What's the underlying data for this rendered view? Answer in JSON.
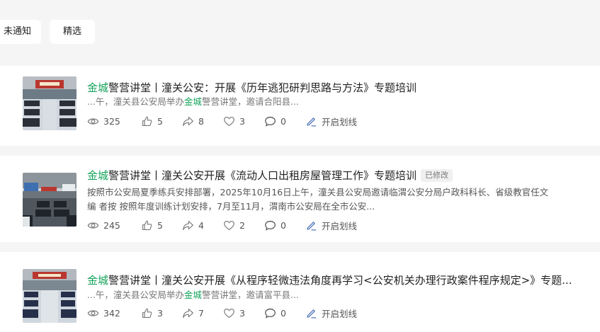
{
  "filters": [
    {
      "label": "未通知"
    },
    {
      "label": "精选"
    }
  ],
  "articles": [
    {
      "title_prefix": "金城",
      "title_rest": "警营讲堂丨潼关公安：开展《历年逃犯研判思路与方法》专题培训",
      "badge": "",
      "snippet_a": "...午，潼关县公安局举办",
      "snippet_hl": "金城",
      "snippet_b": "警营讲堂，邀请合阳县...",
      "views": "325",
      "likes": "5",
      "shares": "8",
      "favorites": "3",
      "comments": "0",
      "action": "开启划线"
    },
    {
      "title_prefix": "金城",
      "title_rest": "警营讲堂丨潼关公安开展《流动人口出租房屋管理工作》专题培训",
      "badge": "已修改",
      "snippet_line1": "按照市公安局夏季练兵安排部署，2025年10月16日上午，潼关县公安局邀请临渭公安分局户政科科长、省级教官任文",
      "snippet_line2": "编 者按 按照年度训练计划安排，7月至11月，渭南市公安局在全市公安...",
      "views": "245",
      "likes": "5",
      "shares": "4",
      "favorites": "2",
      "comments": "0",
      "action": "开启划线"
    },
    {
      "title_prefix": "金城",
      "title_rest": "警营讲堂丨潼关公安开展《从程序轻微违法角度再学习<公安机关办理行政案件程序规定>》专题...",
      "badge": "",
      "snippet_a": "...午，潼关县公安局举办",
      "snippet_hl": "金城",
      "snippet_b": "警营讲堂，邀请富平县...",
      "views": "342",
      "likes": "3",
      "shares": "7",
      "favorites": "3",
      "comments": "0",
      "action": "开启划线"
    }
  ],
  "icons": {
    "views": "eye-icon",
    "likes": "thumbs-up-icon",
    "shares": "share-icon",
    "favorites": "heart-icon",
    "comments": "comment-icon",
    "action": "pen-icon"
  },
  "colors": {
    "highlight": "#13a35a",
    "background": "#f5f5f6",
    "card": "#ffffff",
    "text_muted": "#777777"
  }
}
